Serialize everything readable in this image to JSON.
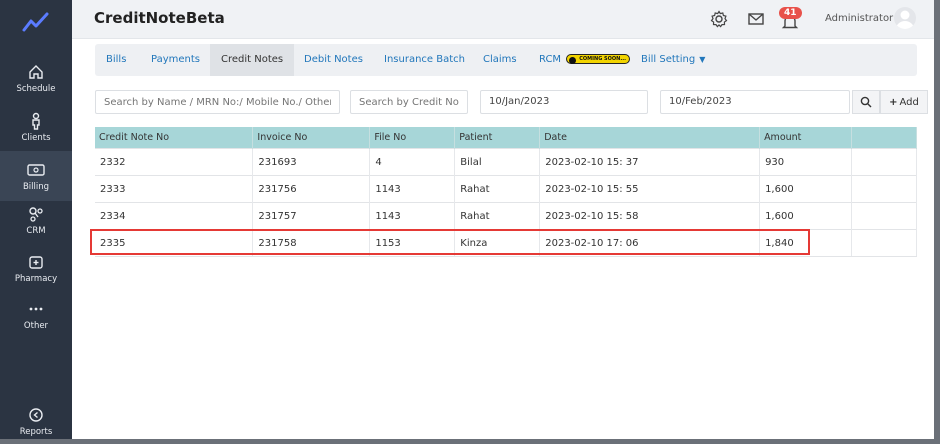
{
  "app": {
    "title": "CreditNoteBeta"
  },
  "sidebar": {
    "items": [
      {
        "label": "Schedule",
        "icon": "home-icon"
      },
      {
        "label": "Clients",
        "icon": "person-icon"
      },
      {
        "label": "Billing",
        "icon": "billing-icon"
      },
      {
        "label": "CRM",
        "icon": "crm-icon"
      },
      {
        "label": "Pharmacy",
        "icon": "pharmacy-icon"
      },
      {
        "label": "Other",
        "icon": "more-icon"
      },
      {
        "label": "Reports",
        "icon": "reports-icon"
      }
    ],
    "active": "Billing"
  },
  "header": {
    "notification_count": "41",
    "user": "Administrator"
  },
  "tabs": [
    {
      "label": "Bills"
    },
    {
      "label": "Payments"
    },
    {
      "label": "Credit Notes"
    },
    {
      "label": "Debit Notes"
    },
    {
      "label": "Insurance Batch"
    },
    {
      "label": "Claims"
    },
    {
      "label": "RCM",
      "badge": "COMING SOON..."
    },
    {
      "label": "Bill Setting"
    }
  ],
  "filters": {
    "search_placeholder": "Search by Name / MRN No:/ Mobile No./ Other ID",
    "credit_placeholder": "Search by Credit Note",
    "date_from": "10/Jan/2023",
    "date_to": "10/Feb/2023",
    "add_label": "Add"
  },
  "table": {
    "columns": [
      "Credit Note No",
      "Invoice No",
      "File No",
      "Patient",
      "Date",
      "Amount",
      ""
    ],
    "rows": [
      [
        "2332",
        "231693",
        "4",
        "Bilal",
        "2023-02-10 15: 37",
        "930",
        ""
      ],
      [
        "2333",
        "231756",
        "1143",
        "Rahat",
        "2023-02-10 15: 55",
        "1,600",
        ""
      ],
      [
        "2334",
        "231757",
        "1143",
        "Rahat",
        "2023-02-10 15: 58",
        "1,600",
        ""
      ],
      [
        "2335",
        "231758",
        "1153",
        "Kinza",
        "2023-02-10 17: 06",
        "1,840",
        ""
      ]
    ]
  },
  "colors": {
    "sidebar": "#2b3442",
    "table_header": "#a7d6d8",
    "link": "#2277bb",
    "highlight": "#e53935",
    "badge": "#e8514a"
  }
}
